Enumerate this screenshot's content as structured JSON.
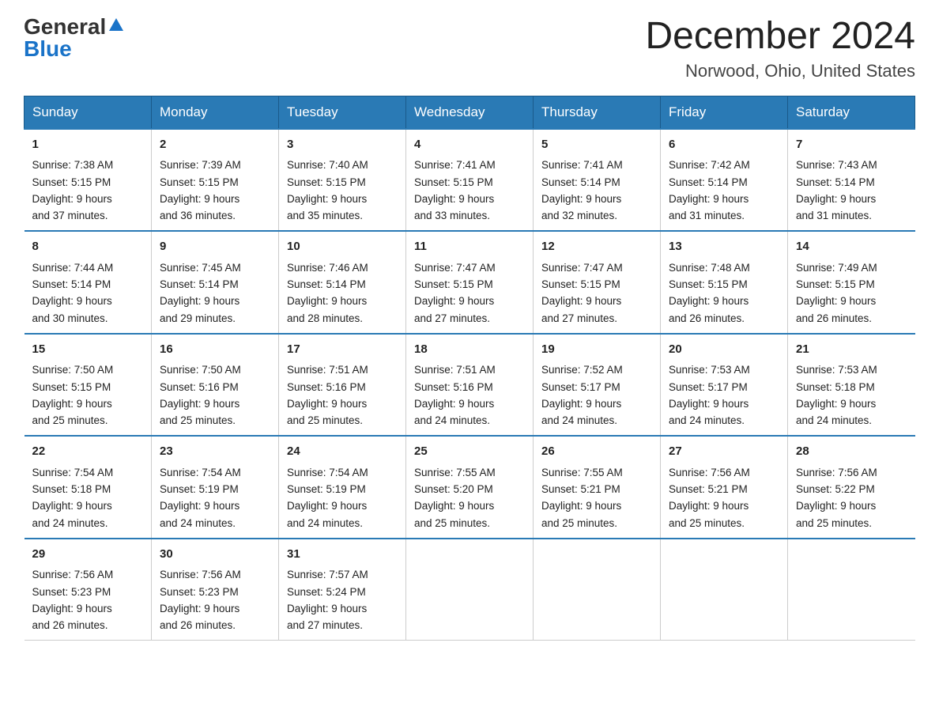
{
  "logo": {
    "general": "General",
    "blue": "Blue"
  },
  "title": {
    "month": "December 2024",
    "location": "Norwood, Ohio, United States"
  },
  "weekdays": [
    "Sunday",
    "Monday",
    "Tuesday",
    "Wednesday",
    "Thursday",
    "Friday",
    "Saturday"
  ],
  "weeks": [
    [
      {
        "day": "1",
        "sunrise": "7:38 AM",
        "sunset": "5:15 PM",
        "daylight": "9 hours and 37 minutes."
      },
      {
        "day": "2",
        "sunrise": "7:39 AM",
        "sunset": "5:15 PM",
        "daylight": "9 hours and 36 minutes."
      },
      {
        "day": "3",
        "sunrise": "7:40 AM",
        "sunset": "5:15 PM",
        "daylight": "9 hours and 35 minutes."
      },
      {
        "day": "4",
        "sunrise": "7:41 AM",
        "sunset": "5:15 PM",
        "daylight": "9 hours and 33 minutes."
      },
      {
        "day": "5",
        "sunrise": "7:41 AM",
        "sunset": "5:14 PM",
        "daylight": "9 hours and 32 minutes."
      },
      {
        "day": "6",
        "sunrise": "7:42 AM",
        "sunset": "5:14 PM",
        "daylight": "9 hours and 31 minutes."
      },
      {
        "day": "7",
        "sunrise": "7:43 AM",
        "sunset": "5:14 PM",
        "daylight": "9 hours and 31 minutes."
      }
    ],
    [
      {
        "day": "8",
        "sunrise": "7:44 AM",
        "sunset": "5:14 PM",
        "daylight": "9 hours and 30 minutes."
      },
      {
        "day": "9",
        "sunrise": "7:45 AM",
        "sunset": "5:14 PM",
        "daylight": "9 hours and 29 minutes."
      },
      {
        "day": "10",
        "sunrise": "7:46 AM",
        "sunset": "5:14 PM",
        "daylight": "9 hours and 28 minutes."
      },
      {
        "day": "11",
        "sunrise": "7:47 AM",
        "sunset": "5:15 PM",
        "daylight": "9 hours and 27 minutes."
      },
      {
        "day": "12",
        "sunrise": "7:47 AM",
        "sunset": "5:15 PM",
        "daylight": "9 hours and 27 minutes."
      },
      {
        "day": "13",
        "sunrise": "7:48 AM",
        "sunset": "5:15 PM",
        "daylight": "9 hours and 26 minutes."
      },
      {
        "day": "14",
        "sunrise": "7:49 AM",
        "sunset": "5:15 PM",
        "daylight": "9 hours and 26 minutes."
      }
    ],
    [
      {
        "day": "15",
        "sunrise": "7:50 AM",
        "sunset": "5:15 PM",
        "daylight": "9 hours and 25 minutes."
      },
      {
        "day": "16",
        "sunrise": "7:50 AM",
        "sunset": "5:16 PM",
        "daylight": "9 hours and 25 minutes."
      },
      {
        "day": "17",
        "sunrise": "7:51 AM",
        "sunset": "5:16 PM",
        "daylight": "9 hours and 25 minutes."
      },
      {
        "day": "18",
        "sunrise": "7:51 AM",
        "sunset": "5:16 PM",
        "daylight": "9 hours and 24 minutes."
      },
      {
        "day": "19",
        "sunrise": "7:52 AM",
        "sunset": "5:17 PM",
        "daylight": "9 hours and 24 minutes."
      },
      {
        "day": "20",
        "sunrise": "7:53 AM",
        "sunset": "5:17 PM",
        "daylight": "9 hours and 24 minutes."
      },
      {
        "day": "21",
        "sunrise": "7:53 AM",
        "sunset": "5:18 PM",
        "daylight": "9 hours and 24 minutes."
      }
    ],
    [
      {
        "day": "22",
        "sunrise": "7:54 AM",
        "sunset": "5:18 PM",
        "daylight": "9 hours and 24 minutes."
      },
      {
        "day": "23",
        "sunrise": "7:54 AM",
        "sunset": "5:19 PM",
        "daylight": "9 hours and 24 minutes."
      },
      {
        "day": "24",
        "sunrise": "7:54 AM",
        "sunset": "5:19 PM",
        "daylight": "9 hours and 24 minutes."
      },
      {
        "day": "25",
        "sunrise": "7:55 AM",
        "sunset": "5:20 PM",
        "daylight": "9 hours and 25 minutes."
      },
      {
        "day": "26",
        "sunrise": "7:55 AM",
        "sunset": "5:21 PM",
        "daylight": "9 hours and 25 minutes."
      },
      {
        "day": "27",
        "sunrise": "7:56 AM",
        "sunset": "5:21 PM",
        "daylight": "9 hours and 25 minutes."
      },
      {
        "day": "28",
        "sunrise": "7:56 AM",
        "sunset": "5:22 PM",
        "daylight": "9 hours and 25 minutes."
      }
    ],
    [
      {
        "day": "29",
        "sunrise": "7:56 AM",
        "sunset": "5:23 PM",
        "daylight": "9 hours and 26 minutes."
      },
      {
        "day": "30",
        "sunrise": "7:56 AM",
        "sunset": "5:23 PM",
        "daylight": "9 hours and 26 minutes."
      },
      {
        "day": "31",
        "sunrise": "7:57 AM",
        "sunset": "5:24 PM",
        "daylight": "9 hours and 27 minutes."
      },
      null,
      null,
      null,
      null
    ]
  ],
  "labels": {
    "sunrise": "Sunrise:",
    "sunset": "Sunset:",
    "daylight": "Daylight:"
  }
}
